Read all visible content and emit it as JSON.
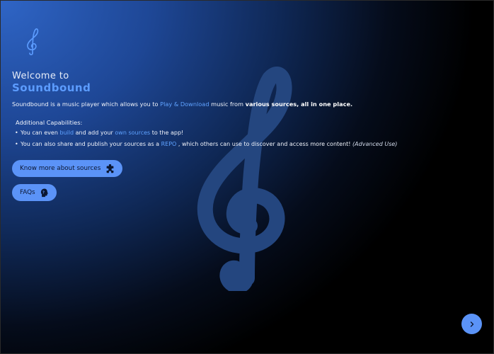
{
  "header": {
    "welcome_text": "Welcome to",
    "app_name": "Soundbound"
  },
  "intro": {
    "part1": "Soundbound is a music player which allows you to ",
    "highlight": "Play & Download",
    "part2": " music from ",
    "strong": "various sources, all in one place."
  },
  "capabilities": {
    "title": "Additional Capabilities:",
    "item1": {
      "bullet": "•",
      "a": "You can even ",
      "b": "build",
      "c": " and add your ",
      "d": "own sources",
      "e": " to the app!"
    },
    "item2": {
      "bullet": "•",
      "a": "You can also share and publish your sources as a ",
      "b": "REPO",
      "c": " , which others can use to discover and access more content! ",
      "d": "(Advanced Use)"
    }
  },
  "buttons": {
    "sources_label": "Know more about sources",
    "faqs_label": "FAQs"
  },
  "icons": {
    "logo": "treble-clef-icon",
    "sources": "puzzle-piece-icon",
    "faqs": "head-question-icon",
    "next": "chevron-right-icon"
  },
  "colors": {
    "accent": "#5b93f7",
    "highlight_text": "#5fa2ff",
    "bg_top_left": "#2f65c6",
    "bg_bottom_right": "#000000"
  }
}
